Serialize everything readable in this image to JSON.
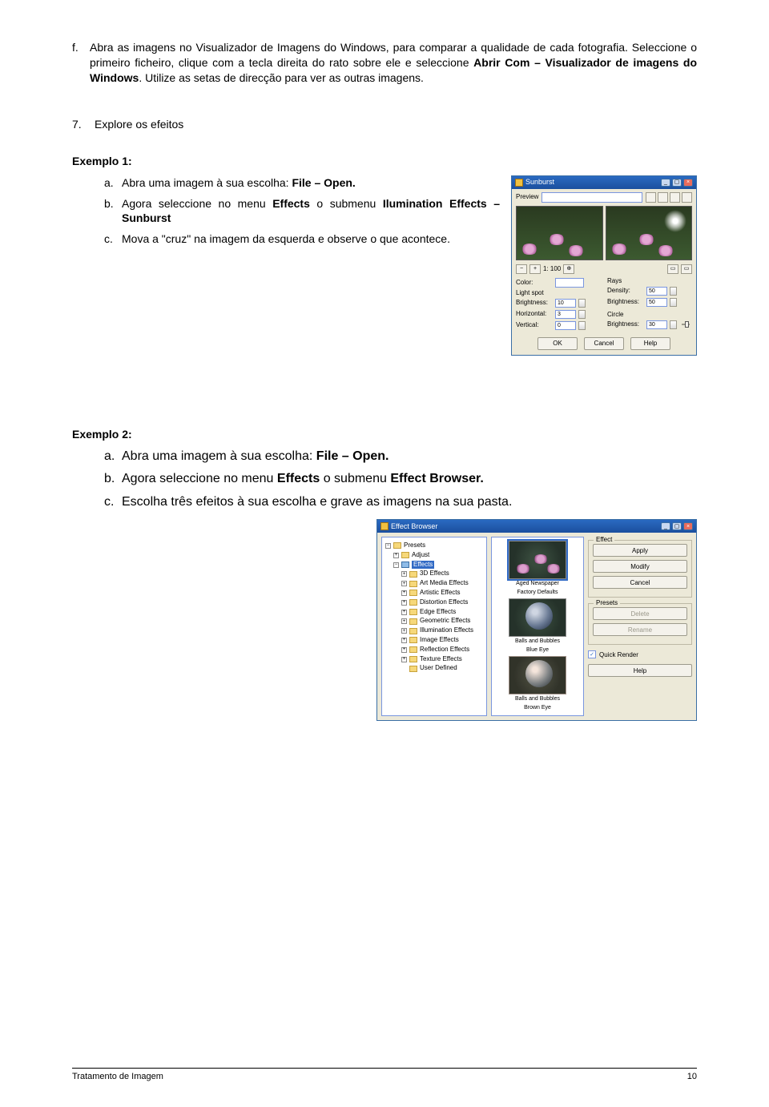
{
  "intro": {
    "marker": "f.",
    "text": "Abra as imagens no Visualizador de Imagens do Windows, para comparar a qualidade de cada fotografia. Seleccione o primeiro ficheiro, clique com a tecla direita do rato sobre ele e seleccione Abrir Com – Visualizador de imagens do Windows. Utilize as setas de direcção para ver as outras imagens.",
    "bold": [
      "Abrir Com – Visualizador de imagens do Windows"
    ]
  },
  "section7": {
    "num": "7.",
    "title": "Explore os efeitos"
  },
  "ex1": {
    "title": "Exemplo 1:",
    "a": {
      "m": "a.",
      "pre": "Abra uma imagem à sua escolha: ",
      "b": "File – Open."
    },
    "b": {
      "m": "b.",
      "pre": "Agora seleccione no menu ",
      "b1": "Effects",
      "mid": " o submenu ",
      "b2": "Ilumination Effects – Sunburst"
    },
    "c": {
      "m": "c.",
      "t": "Mova a \"cruz\" na imagem da esquerda e observe o que acontece."
    }
  },
  "ex2": {
    "title": "Exemplo 2:",
    "a": {
      "m": "a.",
      "pre": "Abra uma imagem à sua escolha: ",
      "b": "File – Open."
    },
    "b": {
      "m": "b.",
      "pre": "Agora seleccione no menu ",
      "b1": "Effects",
      "mid": " o submenu ",
      "b2": "Effect Browser."
    },
    "c": {
      "m": "c.",
      "t": "Escolha três efeitos à sua escolha e grave as imagens na sua pasta."
    }
  },
  "footer": {
    "left": "Tratamento de Imagem",
    "right": "10"
  },
  "sunburst": {
    "title": "Sunburst",
    "preview": "Preview",
    "nav_pct": "1: 100",
    "color": "Color:",
    "lightspot": "Light spot",
    "brightness": "Brightness:",
    "brightness_v": "10",
    "horizontal": "Horizontal:",
    "horizontal_v": "3",
    "vertical": "Vertical:",
    "vertical_v": "0",
    "rays": "Rays",
    "density": "Density:",
    "density_v": "50",
    "r_brightness": "Brightness:",
    "r_brightness_v": "50",
    "circle": "Circle",
    "c_brightness": "Brightness:",
    "c_brightness_v": "30",
    "ok": "OK",
    "cancel": "Cancel",
    "help": "Help"
  },
  "eb": {
    "title": "Effect Browser",
    "tree": {
      "presets": "Presets",
      "adjust": "Adjust",
      "effects": "Effects",
      "n3d": "3D Effects",
      "art": "Art Media Effects",
      "artistic": "Artistic Effects",
      "dist": "Distortion Effects",
      "edge": "Edge Effects",
      "geo": "Geometric Effects",
      "illum": "Illumination Effects",
      "img": "Image Effects",
      "refl": "Reflection Effects",
      "tex": "Texture Effects",
      "user": "User Defined"
    },
    "thumbs": {
      "t1a": "Aged Newspaper",
      "t1b": "Factory Defaults",
      "t2a": "Balls and Bubbles",
      "t2b": "Blue Eye",
      "t3a": "Balls and Bubbles",
      "t3b": "Brown Eye"
    },
    "side": {
      "effect": "Effect",
      "apply": "Apply",
      "modify": "Modify",
      "cancel": "Cancel",
      "presets": "Presets",
      "delete": "Delete",
      "rename": "Rename",
      "quick": "Quick Render",
      "help": "Help"
    }
  }
}
